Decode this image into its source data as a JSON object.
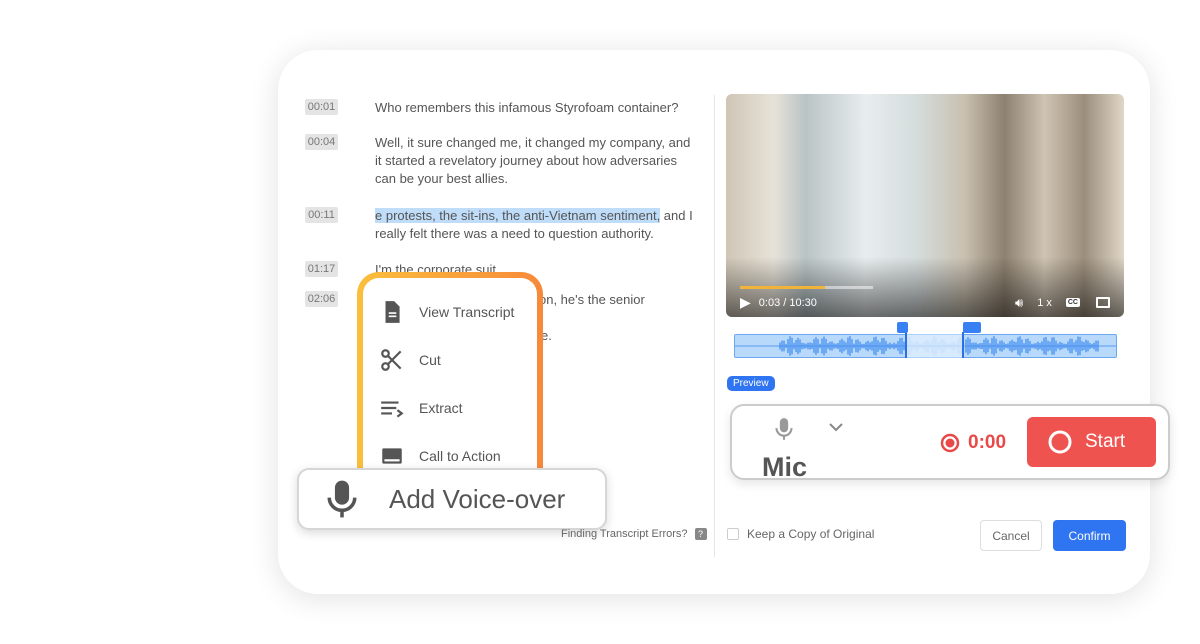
{
  "transcript": [
    {
      "time": "00:01",
      "text": "Who remembers this infamous Styrofoam container?"
    },
    {
      "time": "00:04",
      "text": "Well, it sure changed me, it changed my company, and it started a revelatory journey about how adversaries can be your best allies."
    },
    {
      "time": "00:11",
      "highlight": "e protests, the sit-ins, the anti-Vietnam sentiment,",
      "text": " and I really felt there was a need to question authority."
    },
    {
      "time": "01:17",
      "text": "I'm the corporate suit."
    },
    {
      "time": "02:06",
      "text": "on, he's the senior scientist",
      "text2": "e."
    }
  ],
  "menu": {
    "items": [
      {
        "label": "View Transcript",
        "icon": "document-icon"
      },
      {
        "label": "Cut",
        "icon": "scissors-icon"
      },
      {
        "label": "Extract",
        "icon": "extract-icon"
      },
      {
        "label": "Call to Action",
        "icon": "cta-icon"
      }
    ],
    "gradient": [
      "#fbbf3c",
      "#f7893a"
    ]
  },
  "voiceover": {
    "label": "Add Voice-over"
  },
  "errors": {
    "label": "Finding Transcript Errors?",
    "help": "?"
  },
  "video": {
    "time": "0:03 / 10:30",
    "speed": "1 x",
    "cc": "CC",
    "progress": 0.64
  },
  "preview": "Preview",
  "recorder": {
    "mic": "Mic",
    "time": "0:00",
    "start": "Start",
    "color": "#ef5350"
  },
  "keep": "Keep a Copy of Original",
  "cancel": "Cancel",
  "confirm": "Confirm",
  "accent": "#2f74f0"
}
